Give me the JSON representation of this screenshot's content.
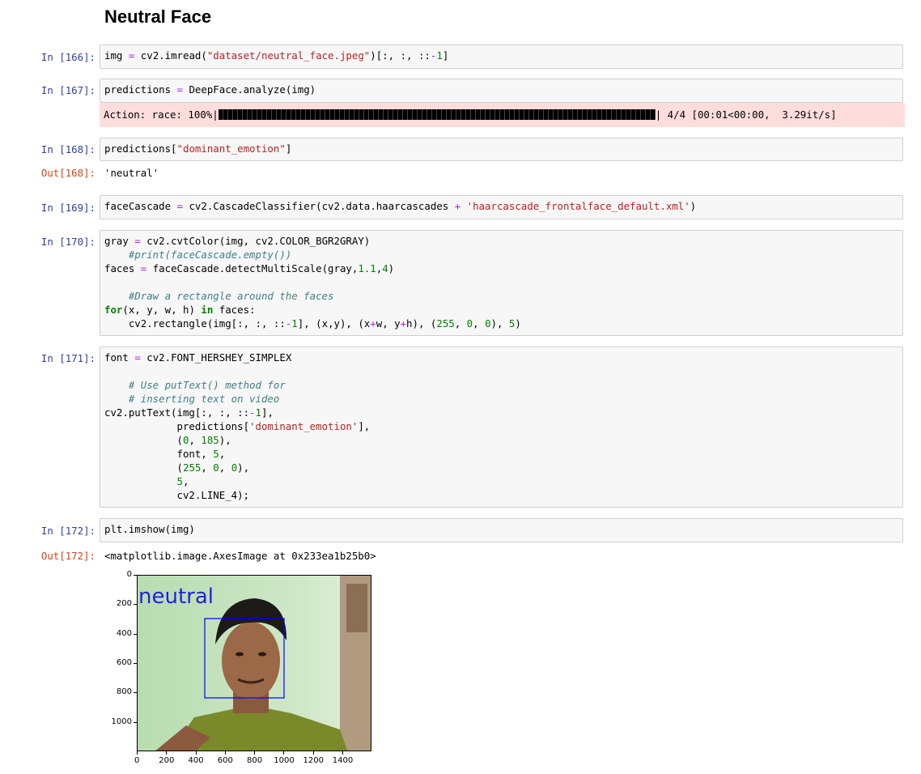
{
  "heading": "Neutral Face",
  "cells": {
    "c166": {
      "prompt": "In [166]:"
    },
    "c167": {
      "prompt": "In [167]:",
      "stderr_prefix": "Action: race: 100%|",
      "stderr_suffix": "| 4/4 [00:01<00:00,  3.29it/s]"
    },
    "c168": {
      "prompt": "In [168]:",
      "out_prompt": "Out[168]:",
      "output": "'neutral'"
    },
    "c169": {
      "prompt": "In [169]:"
    },
    "c170": {
      "prompt": "In [170]:"
    },
    "c171": {
      "prompt": "In [171]:"
    },
    "c172": {
      "prompt": "In [172]:",
      "out_prompt": "Out[172]:",
      "output": "<matplotlib.image.AxesImage at 0x233ea1b25b0>"
    }
  },
  "plot": {
    "overlay_text": "neutral",
    "rectangle_color": "#0000ff",
    "x_ticks": [
      "0",
      "200",
      "400",
      "600",
      "800",
      "1000",
      "1200",
      "1400"
    ],
    "y_ticks": [
      "0",
      "200",
      "400",
      "600",
      "800",
      "1000"
    ]
  }
}
